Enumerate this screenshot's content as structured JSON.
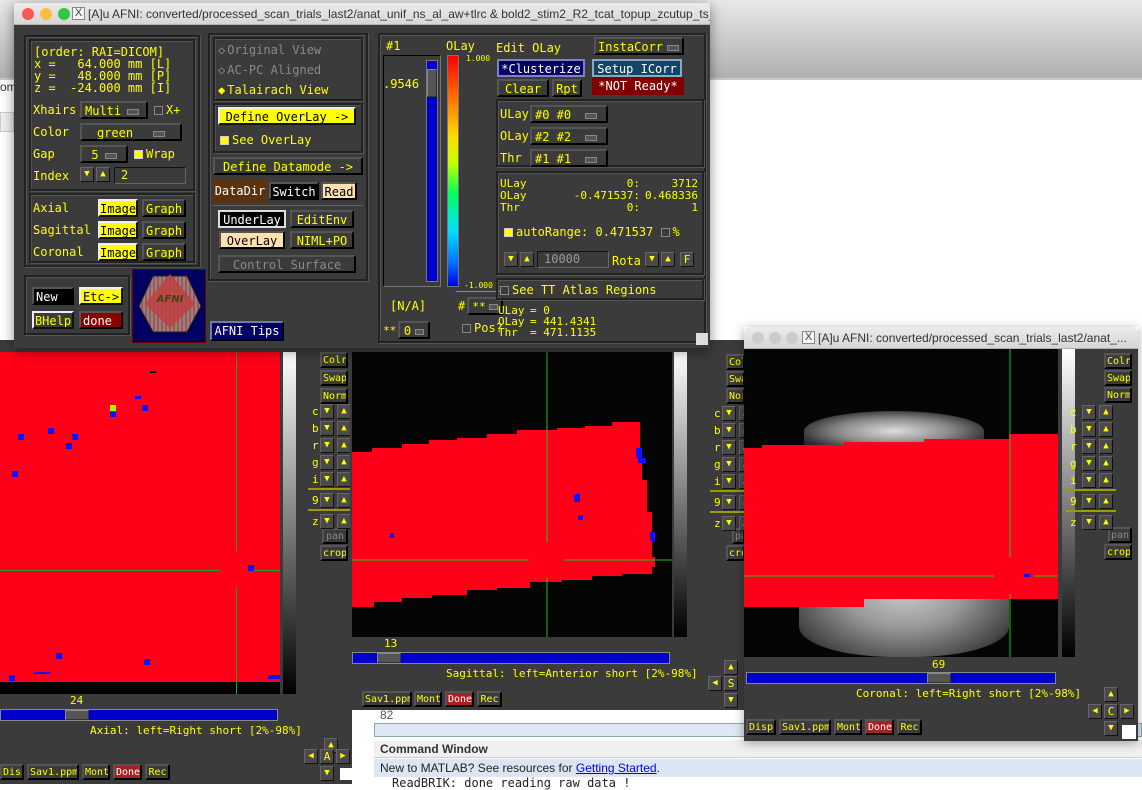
{
  "background": {
    "left_fragment": "om",
    "matlab_line_number": "82",
    "command_window": {
      "title": "Command Window",
      "banner_prefix": "New to MATLAB? See resources for ",
      "banner_link": "Getting Started",
      "banner_suffix": ".",
      "output_line": "ReadBRIK: done reading raw data !"
    }
  },
  "main_window": {
    "title": "[A]u AFNI: converted/processed_scan_trials_last2/anat_unif_ns_al_aw+tlrc & bold2_stim2_R2_tcat_topup_zcutup_ts_a...",
    "coords": {
      "order": "[order: RAI=DICOM]",
      "x": "x =   64.000 mm [L]",
      "y": "y =   48.000 mm [P]",
      "z": "z =  -24.000 mm [I]"
    },
    "xhairs": {
      "label": "Xhairs",
      "value": "Multi",
      "xplus_label": "X+",
      "xplus_checked": false
    },
    "color": {
      "label": "Color",
      "value": "green"
    },
    "gap": {
      "label": "Gap",
      "value": "5",
      "wrap_label": "Wrap",
      "wrap_checked": true
    },
    "index": {
      "label": "Index",
      "value": "2"
    },
    "views": [
      {
        "label": "Axial",
        "image": "Image",
        "graph": "Graph"
      },
      {
        "label": "Sagittal",
        "image": "Image",
        "graph": "Graph"
      },
      {
        "label": "Coronal",
        "image": "Image",
        "graph": "Graph"
      }
    ],
    "bottom_buttons": {
      "new": "New",
      "etc": "Etc->",
      "bhelp": "BHelp",
      "done": "done"
    },
    "logo_text": "AFNI",
    "tips": "AFNI Tips",
    "view_modes": [
      {
        "label": "Original View",
        "selected": false
      },
      {
        "label": "AC-PC Aligned",
        "selected": false
      },
      {
        "label": "Talairach View",
        "selected": true
      }
    ],
    "define_overlay": "Define OverLay ->",
    "see_overlay": {
      "label": "See OverLay",
      "checked": true
    },
    "define_datamode": "Define Datamode ->",
    "datadir": "DataDir",
    "switch": "Switch",
    "read": "Read",
    "underlay": "UnderLay",
    "editenv": "EditEnv",
    "overlay": "OverLay",
    "niml": "NIML+PO",
    "control_surface": "Control Surface"
  },
  "overlay_panel": {
    "index_label": "#1",
    "olay_label": "OLay",
    "threshold_value": ".9546",
    "threshold_slider_fraction": 0.95,
    "colorbar_top": "1.000",
    "colorbar_bottom": "-1.000",
    "na_label": "[N/A]",
    "hash_label": "#",
    "hash_menu": "**",
    "star_label": "**",
    "star_menu": "0",
    "pos_label": "Pos?",
    "pos_checked": false,
    "edit_olay": "Edit OLay",
    "instacorr": "InstaCorr",
    "clusterize": "*Clusterize",
    "setup_icorr": "Setup ICorr",
    "clear": "Clear",
    "rpt": "Rpt",
    "not_ready": "*NOT Ready*",
    "selectors": [
      {
        "label": "ULay",
        "value": "#0 #0"
      },
      {
        "label": "OLay",
        "value": "#2 #2"
      },
      {
        "label": "Thr",
        "value": "#1 #1"
      }
    ],
    "ranges": [
      {
        "label": "ULay",
        "min": "0:",
        "max": "3712"
      },
      {
        "label": "OLay",
        "min": "-0.471537:",
        "max": "0.468336"
      },
      {
        "label": "Thr",
        "min": "0:",
        "max": "1"
      }
    ],
    "autorange": {
      "label": "autoRange:",
      "value": "0.471537",
      "checked": true,
      "pct_label": "%",
      "pct_checked": false
    },
    "range_field": "10000",
    "rota": "Rota",
    "f_button": "F",
    "see_atlas": {
      "label": "See TT Atlas Regions",
      "checked": false
    },
    "values": [
      {
        "label": "ULay",
        "value": "= 0"
      },
      {
        "label": "OLay",
        "value": "= 441.4341"
      },
      {
        "label": "Thr",
        "value": "= 471.1135"
      }
    ]
  },
  "image_viewers": [
    {
      "name": "axial",
      "slice": "24",
      "caption": "Axial: left=Right short [2%-98%]",
      "nav_letter": "A",
      "slider_fraction": 0.3
    },
    {
      "name": "sagittal",
      "slice": "13",
      "caption": "Sagittal: left=Anterior short [2%-98%]",
      "nav_letter": "S",
      "slider_fraction": 0.12
    },
    {
      "name": "coronal",
      "slice": "69",
      "caption": "Coronal: left=Right short [2%-98%]",
      "nav_letter": "C",
      "slider_fraction": 0.6,
      "title": "[A]u AFNI: converted/processed_scan_trials_last2/anat_..."
    }
  ],
  "viewer_side_buttons": [
    "Colr",
    "Swap",
    "Norm"
  ],
  "viewer_arrow_rows": [
    "c",
    "b",
    "r",
    "g",
    "i",
    "9",
    "z"
  ],
  "viewer_pan": "pan",
  "viewer_crop": "crop",
  "viewer_bottom_buttons": [
    "Disp",
    "Sav1.ppm",
    "Mont",
    "Done",
    "Rec"
  ],
  "colors": {
    "overlay_red": "#ff0018",
    "cluster_blue": "#1010ff",
    "crosshair_green": "#20c020",
    "afni_bg": "#3b3b3b",
    "afni_text": "#ffff00"
  }
}
